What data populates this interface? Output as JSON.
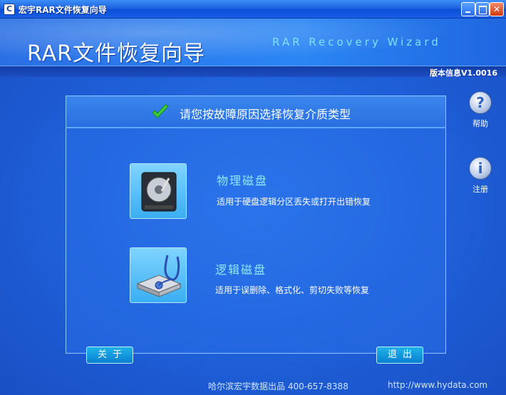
{
  "window": {
    "title": "宏宇RAR文件恢复向导",
    "icon": "app-logo-icon"
  },
  "header": {
    "title": "RAR文件恢复向导",
    "subtitle": "RAR Recovery Wizard",
    "version": "版本信息V1.0016"
  },
  "panel": {
    "heading": "请您按故障原因选择恢复介质类型",
    "options": [
      {
        "title": "物理磁盘",
        "desc": "适用于硬盘逻辑分区丢失或打开出错恢复",
        "icon": "hard-disk-icon"
      },
      {
        "title": "逻辑磁盘",
        "desc": "适用于误删除、格式化、剪切失败等恢复",
        "icon": "disk-stethoscope-icon"
      }
    ]
  },
  "side": {
    "help_label": "帮助",
    "register_label": "注册"
  },
  "buttons": {
    "about": "关于",
    "exit": "退出"
  },
  "footer": {
    "company": "哈尔滨宏宇数据出品 400-657-8388",
    "url": "http://www.hydata.com"
  },
  "colors": {
    "accent": "#8fe6ff",
    "background": "#1e5fd8"
  }
}
